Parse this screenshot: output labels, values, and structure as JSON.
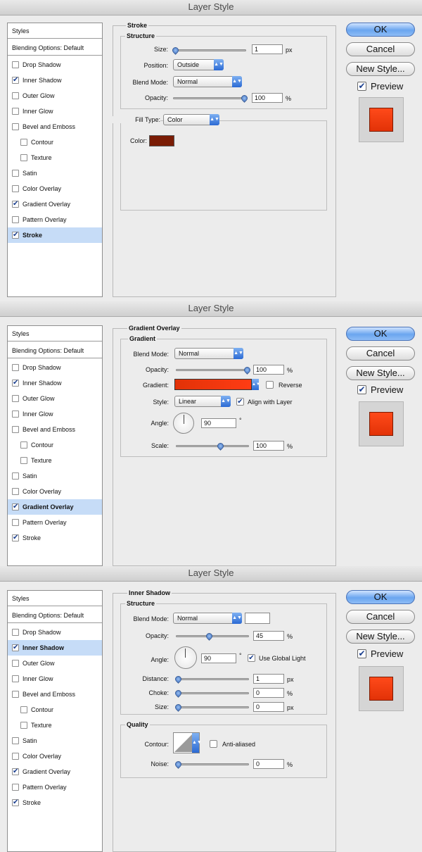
{
  "dialog_title": "Layer Style",
  "buttons": {
    "ok": "OK",
    "cancel": "Cancel",
    "new_style": "New Style...",
    "preview": "Preview"
  },
  "styles_list": {
    "header": "Styles",
    "blending": "Blending Options: Default",
    "items": [
      {
        "label": "Drop Shadow"
      },
      {
        "label": "Inner Shadow"
      },
      {
        "label": "Outer Glow"
      },
      {
        "label": "Inner Glow"
      },
      {
        "label": "Bevel and Emboss"
      },
      {
        "label": "Contour"
      },
      {
        "label": "Texture"
      },
      {
        "label": "Satin"
      },
      {
        "label": "Color Overlay"
      },
      {
        "label": "Gradient Overlay"
      },
      {
        "label": "Pattern Overlay"
      },
      {
        "label": "Stroke"
      }
    ]
  },
  "panel1": {
    "title": "Stroke",
    "structure": "Structure",
    "size_label": "Size:",
    "size_value": "1",
    "size_unit": "px",
    "position_label": "Position:",
    "position_value": "Outside",
    "blend_label": "Blend Mode:",
    "blend_value": "Normal",
    "opacity_label": "Opacity:",
    "opacity_value": "100",
    "opacity_unit": "%",
    "fill_type_label": "Fill Type:",
    "fill_type_value": "Color",
    "color_label": "Color:",
    "color_hex": "#7a1c05"
  },
  "panel2": {
    "title": "Gradient Overlay",
    "gradient_section": "Gradient",
    "blend_label": "Blend Mode:",
    "blend_value": "Normal",
    "opacity_label": "Opacity:",
    "opacity_value": "100",
    "opacity_unit": "%",
    "gradient_label": "Gradient:",
    "reverse_label": "Reverse",
    "style_label": "Style:",
    "style_value": "Linear",
    "align_label": "Align with Layer",
    "angle_label": "Angle:",
    "angle_value": "90",
    "angle_unit": "°",
    "scale_label": "Scale:",
    "scale_value": "100",
    "scale_unit": "%"
  },
  "panel3": {
    "title": "Inner Shadow",
    "structure": "Structure",
    "blend_label": "Blend Mode:",
    "blend_value": "Normal",
    "opacity_label": "Opacity:",
    "opacity_value": "45",
    "opacity_unit": "%",
    "angle_label": "Angle:",
    "angle_value": "90",
    "angle_unit": "°",
    "global_light_label": "Use Global Light",
    "distance_label": "Distance:",
    "distance_value": "1",
    "distance_unit": "px",
    "choke_label": "Choke:",
    "choke_value": "0",
    "choke_unit": "%",
    "size_label": "Size:",
    "size_value": "0",
    "size_unit": "px",
    "quality": "Quality",
    "contour_label": "Contour:",
    "anti_aliased_label": "Anti-aliased",
    "noise_label": "Noise:",
    "noise_value": "0",
    "noise_unit": "%"
  },
  "checkmark": "✔",
  "dropdown_arrow": "▲▼",
  "colors": {
    "accent": "#3f74c9",
    "preview": "#e8380d",
    "stroke_color": "#7a1c05"
  }
}
